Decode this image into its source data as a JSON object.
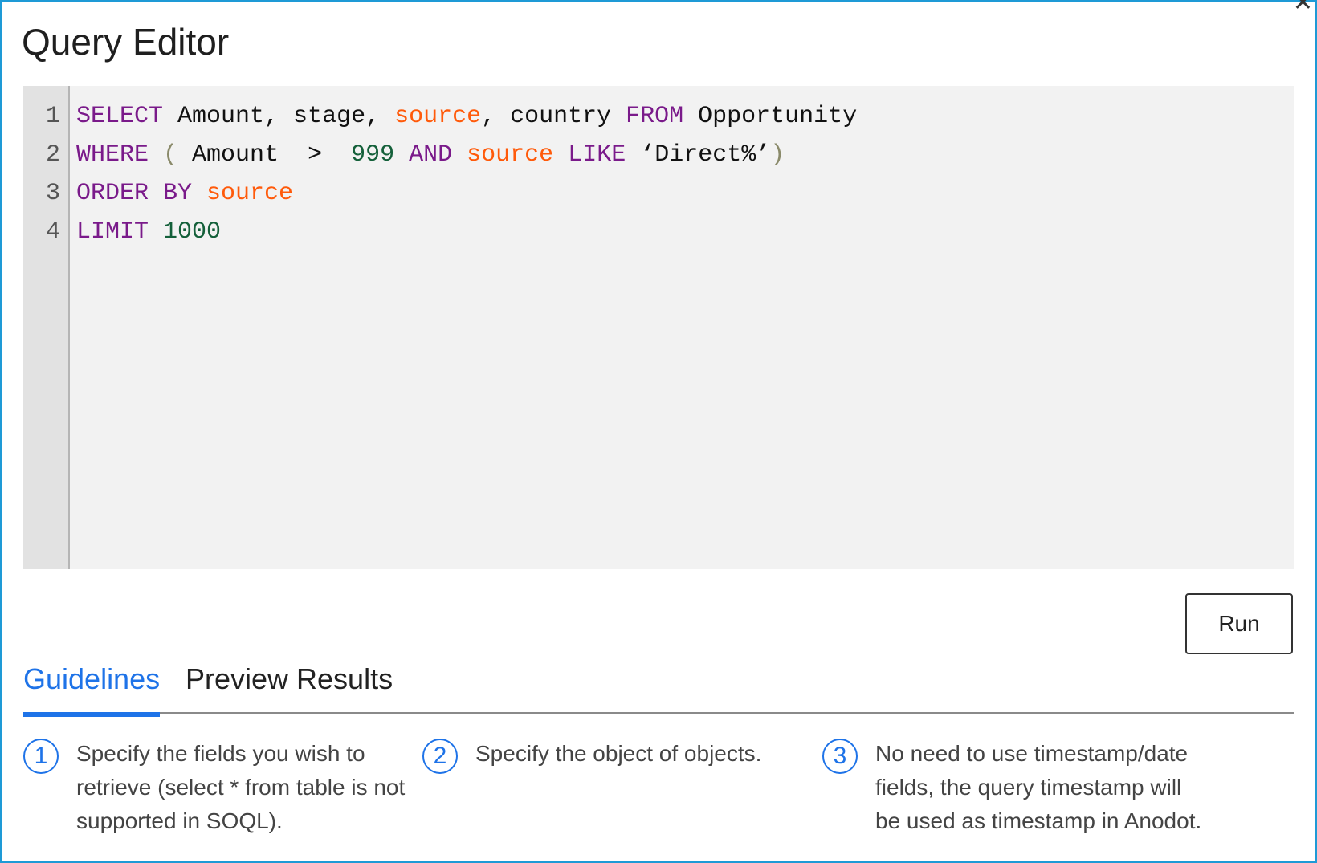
{
  "window": {
    "title": "Query Editor",
    "close_glyph": "✕"
  },
  "editor": {
    "line_numbers": [
      "1",
      "2",
      "3",
      "4"
    ],
    "lines": [
      [
        {
          "t": "SELECT",
          "c": "kw"
        },
        {
          "t": " Amount, stage, ",
          "c": "plain"
        },
        {
          "t": "source",
          "c": "fld"
        },
        {
          "t": ", country ",
          "c": "plain"
        },
        {
          "t": "FROM",
          "c": "kw"
        },
        {
          "t": " Opportunity",
          "c": "plain"
        }
      ],
      [
        {
          "t": "WHERE",
          "c": "kw"
        },
        {
          "t": " ",
          "c": "plain"
        },
        {
          "t": "(",
          "c": "paren"
        },
        {
          "t": " Amount  >  ",
          "c": "plain"
        },
        {
          "t": "999",
          "c": "num"
        },
        {
          "t": " ",
          "c": "plain"
        },
        {
          "t": "AND",
          "c": "kw"
        },
        {
          "t": " ",
          "c": "plain"
        },
        {
          "t": "source",
          "c": "fld"
        },
        {
          "t": " ",
          "c": "plain"
        },
        {
          "t": "LIKE",
          "c": "kw"
        },
        {
          "t": " ‘Direct%’",
          "c": "plain"
        },
        {
          "t": ")",
          "c": "paren"
        }
      ],
      [
        {
          "t": "ORDER BY",
          "c": "kw"
        },
        {
          "t": " ",
          "c": "plain"
        },
        {
          "t": "source",
          "c": "fld"
        }
      ],
      [
        {
          "t": "LIMIT",
          "c": "kw"
        },
        {
          "t": " ",
          "c": "plain"
        },
        {
          "t": "1000",
          "c": "num"
        }
      ]
    ]
  },
  "run_button": {
    "label": "Run"
  },
  "tabs": [
    {
      "label": "Guidelines",
      "active": true
    },
    {
      "label": "Preview Results",
      "active": false
    }
  ],
  "guidelines": [
    {
      "num": "1",
      "text": "Specify the fields you wish to retrieve (select * from table is not supported in SOQL)."
    },
    {
      "num": "2",
      "text": "Specify the object of objects."
    },
    {
      "num": "3",
      "text": "No need to use timestamp/date fields, the query timestamp will be used as timestamp in Anodot."
    }
  ],
  "colors": {
    "keyword": "#7a1a8a",
    "field": "#ff5a0a",
    "number": "#14603a",
    "accent": "#1e73e8",
    "frame": "#1e9ad6"
  }
}
